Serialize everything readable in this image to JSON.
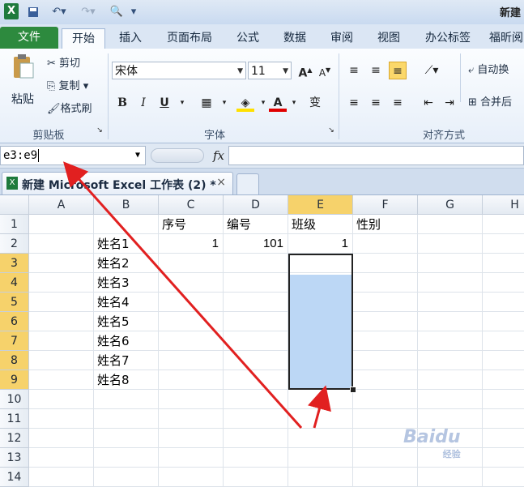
{
  "titlebar": {
    "doc_title": "新建",
    "app_icon": "X",
    "qa_save_icon": "save-icon",
    "qa_undo_icon": "undo-icon",
    "qa_redo_icon": "redo-icon"
  },
  "tabs": [
    "文件",
    "开始",
    "插入",
    "页面布局",
    "公式",
    "数据",
    "审阅",
    "视图",
    "办公标签",
    "福昕阅"
  ],
  "ribbon": {
    "clipboard": {
      "paste": "粘贴",
      "cut": "剪切",
      "copy": "复制",
      "format_painter": "格式刷",
      "group_label": "剪贴板"
    },
    "font": {
      "font_name": "宋体",
      "font_size": "11",
      "bold": "B",
      "italic": "I",
      "underline": "U",
      "grow": "A",
      "shrink": "A",
      "font_color": "A",
      "phonetic": "变",
      "group_label": "字体"
    },
    "alignment": {
      "wrap_text": "自动换",
      "merge": "合并后",
      "group_label": "对齐方式"
    }
  },
  "formula_bar": {
    "name_box": "e3:e9",
    "fx": "fx",
    "formula": ""
  },
  "workbook_tab": {
    "label": "新建 Microsoft Excel 工作表 (2) *",
    "close": "×"
  },
  "sheet": {
    "columns": [
      "A",
      "B",
      "C",
      "D",
      "E",
      "F",
      "G",
      "H"
    ],
    "rows": [
      "1",
      "2",
      "3",
      "4",
      "5",
      "6",
      "7",
      "8",
      "9",
      "10",
      "11",
      "12",
      "13",
      "14"
    ],
    "header_row": {
      "C": "序号",
      "D": "编号",
      "E": "班级",
      "F": "性别"
    },
    "row2": {
      "B": "姓名1",
      "C": "1",
      "D": "101",
      "E": "1"
    },
    "names": [
      "姓名2",
      "姓名3",
      "姓名4",
      "姓名5",
      "姓名6",
      "姓名7",
      "姓名8"
    ],
    "selected_range": "E3:E9"
  },
  "watermark": {
    "brand": "Baidu",
    "sub": "经验"
  }
}
